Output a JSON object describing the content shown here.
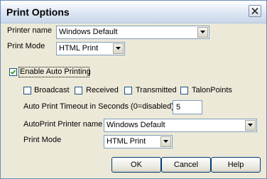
{
  "window": {
    "title": "Print Options",
    "close_icon": "close-icon"
  },
  "printer": {
    "label": "Printer name",
    "value": "Windows Default"
  },
  "print_mode": {
    "label": "Print Mode",
    "value": "HTML Print"
  },
  "auto_printing": {
    "label": "Enable Auto Printing",
    "checked": true
  },
  "auto_options": {
    "broadcast": {
      "label": "Broadcast",
      "checked": false
    },
    "received": {
      "label": "Received",
      "checked": false
    },
    "transmitted": {
      "label": "Transmitted",
      "checked": false
    },
    "talonpoints": {
      "label": "TalonPoints",
      "checked": false
    }
  },
  "timeout": {
    "label": "Auto Print Timeout in Seconds (0=disabled)",
    "value": "5"
  },
  "auto_printer": {
    "label": "AutoPrint Printer name",
    "value": "Windows Default"
  },
  "auto_print_mode": {
    "label": "Print Mode",
    "value": "HTML Print"
  },
  "buttons": {
    "ok": "OK",
    "cancel": "Cancel",
    "help": "Help"
  }
}
